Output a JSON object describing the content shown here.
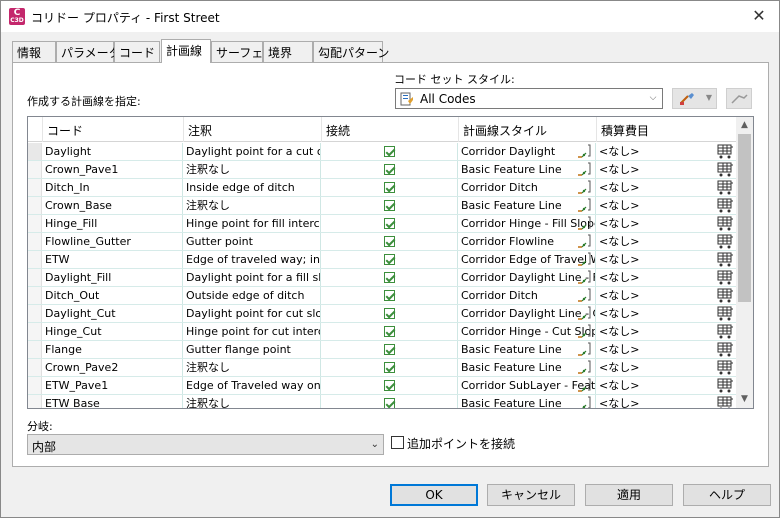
{
  "window": {
    "title": "コリドー プロパティ - First Street",
    "icon_text": "C",
    "icon_sub": "C3D",
    "close_glyph": "✕"
  },
  "tabs": [
    {
      "label": "情報"
    },
    {
      "label": "パラメータ"
    },
    {
      "label": "コード"
    },
    {
      "label": "計画線"
    },
    {
      "label": "サーフェス"
    },
    {
      "label": "境界"
    },
    {
      "label": "勾配パターン"
    }
  ],
  "define_label": "作成する計画線を指定:",
  "code_set_style": {
    "label": "コード セット スタイル:",
    "value": "All Codes"
  },
  "grid": {
    "columns": [
      "コード",
      "注釈",
      "接続",
      "計画線スタイル",
      "積算費目"
    ],
    "rows": [
      {
        "code": "Daylight",
        "desc": "Daylight point for a cut o...",
        "connect": true,
        "style": "Corridor Daylight",
        "pay": "<なし>"
      },
      {
        "code": "Crown_Pave1",
        "desc": "注釈なし",
        "connect": true,
        "style": "Basic Feature Line",
        "pay": "<なし>"
      },
      {
        "code": "Ditch_In",
        "desc": "Inside edge of ditch",
        "connect": true,
        "style": "Corridor Ditch",
        "pay": "<なし>"
      },
      {
        "code": "Crown_Base",
        "desc": "注釈なし",
        "connect": true,
        "style": "Basic Feature Line",
        "pay": "<なし>"
      },
      {
        "code": "Hinge_Fill",
        "desc": "Hinge point for fill interc...",
        "connect": true,
        "style": "Corridor Hinge - Fill Slope",
        "pay": "<なし>"
      },
      {
        "code": "Flowline_Gutter",
        "desc": "Gutter point",
        "connect": true,
        "style": "Corridor Flowline",
        "pay": "<なし>"
      },
      {
        "code": "ETW",
        "desc": "Edge of traveled way; ins...",
        "connect": true,
        "style": "Corridor Edge of Travel Way",
        "pay": "<なし>"
      },
      {
        "code": "Daylight_Fill",
        "desc": "Daylight point for a fill sl...",
        "connect": true,
        "style": "Corridor Daylight Line - Fill",
        "pay": "<なし>"
      },
      {
        "code": "Ditch_Out",
        "desc": "Outside edge of ditch",
        "connect": true,
        "style": "Corridor Ditch",
        "pay": "<なし>"
      },
      {
        "code": "Daylight_Cut",
        "desc": "Daylight point for cut slo...",
        "connect": true,
        "style": "Corridor Daylight Line - Cut",
        "pay": "<なし>"
      },
      {
        "code": "Hinge_Cut",
        "desc": "Hinge point for cut interc...",
        "connect": true,
        "style": "Corridor Hinge - Cut Slope",
        "pay": "<なし>"
      },
      {
        "code": "Flange",
        "desc": "Gutter flange point",
        "connect": true,
        "style": "Basic Feature Line",
        "pay": "<なし>"
      },
      {
        "code": "Crown_Pave2",
        "desc": "注釈なし",
        "connect": true,
        "style": "Basic Feature Line",
        "pay": "<なし>"
      },
      {
        "code": "ETW_Pave1",
        "desc": "Edge of Traveled way on...",
        "connect": true,
        "style": "Corridor SubLayer - Feature",
        "pay": "<なし>"
      },
      {
        "code": "ETW Base",
        "desc": "注釈なし",
        "connect": true,
        "style": "Basic Feature Line",
        "pay": "<なし>"
      }
    ]
  },
  "branch": {
    "label": "分岐:",
    "value": "内部",
    "add_points_label": "追加ポイントを接続"
  },
  "buttons": {
    "ok": "OK",
    "cancel": "キャンセル",
    "apply": "適用",
    "help": "ヘルプ"
  },
  "colors": {
    "accent": "#0078d7",
    "check": "#3c8f3c",
    "app_icon": "#c4276c"
  }
}
